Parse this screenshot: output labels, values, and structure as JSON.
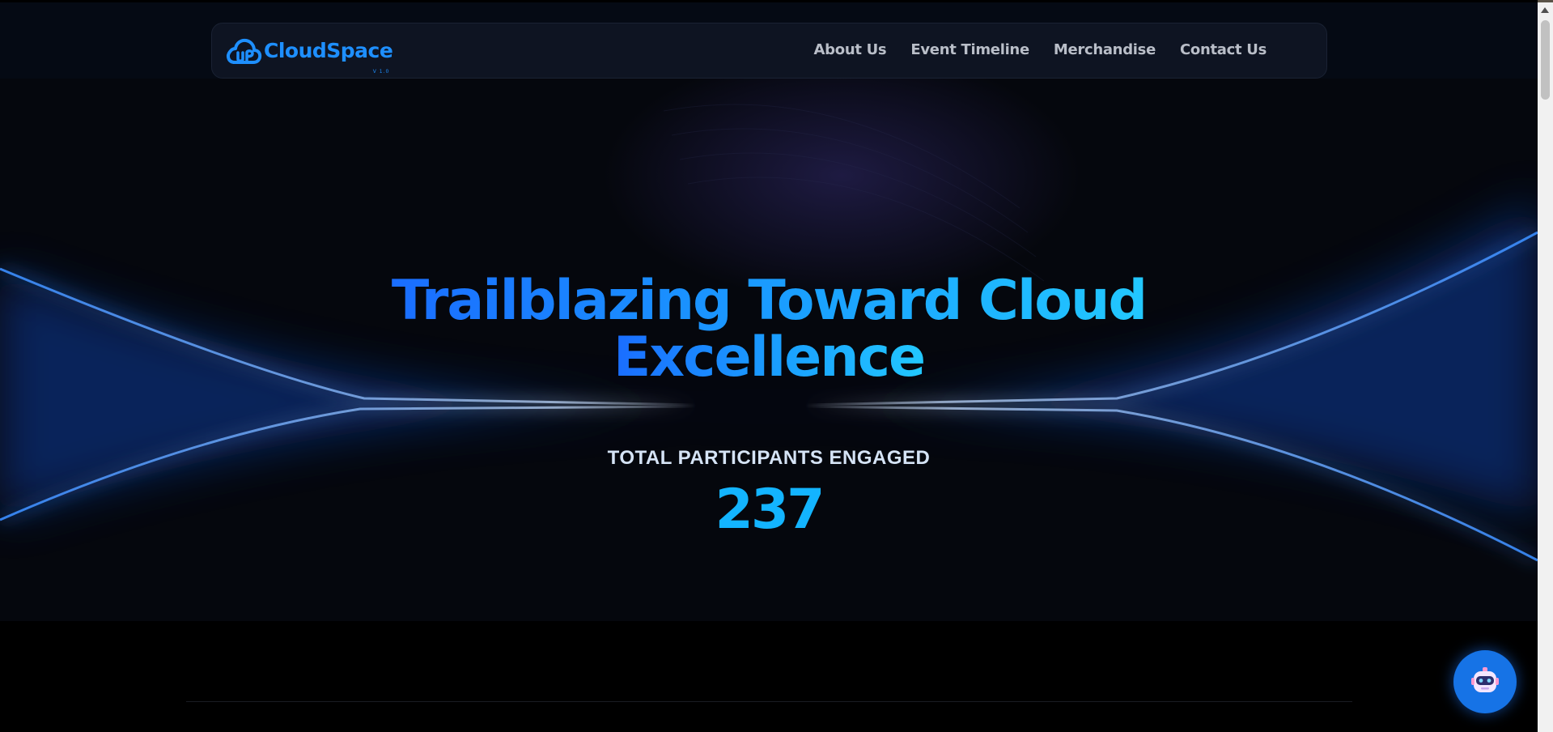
{
  "brand": {
    "name": "CloudSpace",
    "version": "V 1.0",
    "color": "#1e8fff"
  },
  "nav": {
    "links": [
      "About Us",
      "Event Timeline",
      "Merchandise",
      "Contact Us"
    ]
  },
  "hero": {
    "title_line1": "Trailblazing Toward Cloud",
    "title_line2": "Excellence",
    "stat_label": "TOTAL PARTICIPANTS ENGAGED",
    "stat_value": "237"
  },
  "chat": {
    "icon": "robot-icon"
  },
  "colors": {
    "background": "#000000",
    "accent": "#13b4ff",
    "nav_bg": "#0e1422",
    "fab": "#1673e6"
  }
}
